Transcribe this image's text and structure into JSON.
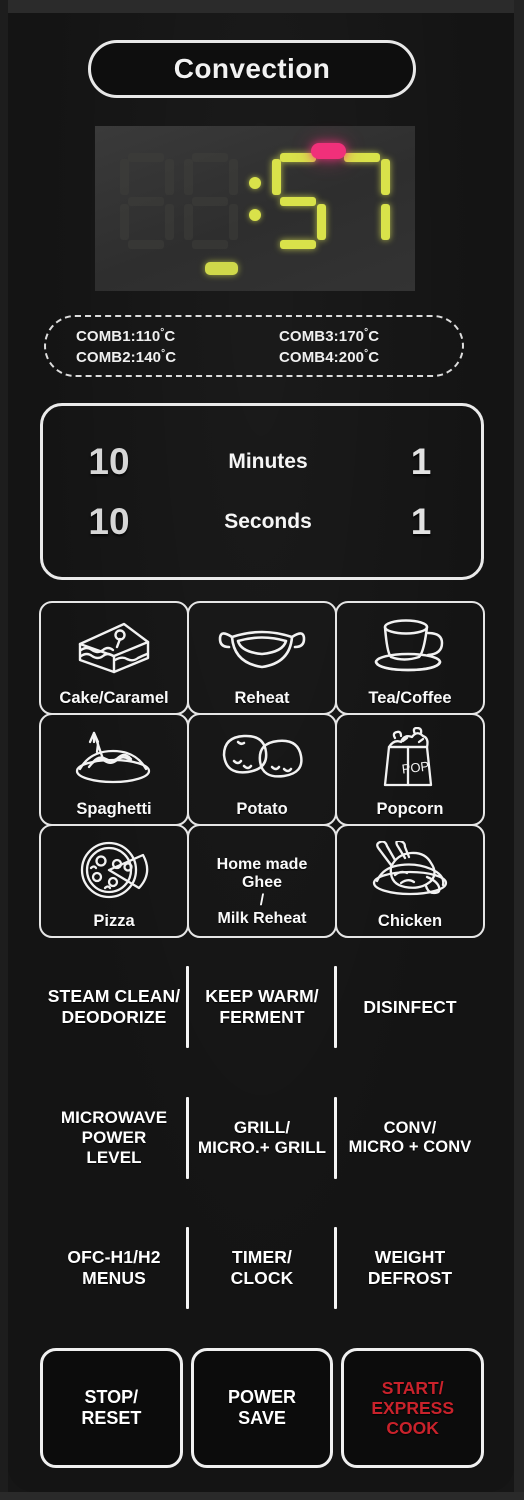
{
  "panel": {
    "header_label": "Convection",
    "accent_red": "#c9222b",
    "led_yellow": "#d9e24a",
    "led_pink": "#f0307a"
  },
  "display": {
    "digits": [
      {
        "value": "8",
        "lit": false
      },
      {
        "value": "8",
        "lit": false
      },
      {
        "value": "5",
        "lit": true
      },
      {
        "value": "7",
        "lit": true
      }
    ],
    "colon": ":",
    "readout": ":57",
    "indicator_pink": "cooking-indicator",
    "indicator_yellow": "mode-indicator"
  },
  "comb": {
    "left": [
      "COMB1:110°C",
      "COMB2:140°C"
    ],
    "right": [
      "COMB3:170°C",
      "COMB4:200°C"
    ],
    "items": [
      {
        "label": "COMB1",
        "temp": "110",
        "unit": "°C"
      },
      {
        "label": "COMB2",
        "temp": "140",
        "unit": "°C"
      },
      {
        "label": "COMB3",
        "temp": "170",
        "unit": "°C"
      },
      {
        "label": "COMB4",
        "temp": "200",
        "unit": "°C"
      }
    ]
  },
  "numpad": {
    "rows": [
      {
        "big": "10",
        "unit": "Minutes",
        "one": "1"
      },
      {
        "big": "10",
        "unit": "Seconds",
        "one": "1"
      }
    ]
  },
  "menu_grid": [
    {
      "label": "Cake/Caramel",
      "icon": "cake-slice-icon"
    },
    {
      "label": "Reheat",
      "icon": "bowl-icon"
    },
    {
      "label": "Tea/Coffee",
      "icon": "coffee-cup-icon"
    },
    {
      "label": "Spaghetti",
      "icon": "spaghetti-plate-icon"
    },
    {
      "label": "Potato",
      "icon": "potato-icon"
    },
    {
      "label": "Popcorn",
      "icon": "popcorn-bag-icon",
      "icon_text": "POP"
    },
    {
      "label": "Pizza",
      "icon": "pizza-icon"
    },
    {
      "label": "Home made Ghee\n/\nMilk Reheat",
      "line1": "Home made",
      "line2": "Ghee",
      "line3": "/",
      "line4": "Milk Reheat",
      "icon": "none"
    },
    {
      "label": "Chicken",
      "icon": "roast-chicken-icon"
    }
  ],
  "function_rows": [
    {
      "cells": [
        {
          "line1": "STEAM CLEAN/",
          "line2": "DEODORIZE"
        },
        {
          "line1": "KEEP WARM/",
          "line2": "FERMENT"
        },
        {
          "line1": "DISINFECT",
          "line2": ""
        }
      ]
    },
    {
      "cells": [
        {
          "line1": "MICROWAVE",
          "line2": "POWER",
          "line3": "LEVEL"
        },
        {
          "line1": "GRILL/",
          "line2": "MICRO.+ GRILL"
        },
        {
          "line1": "CONV/",
          "line2": "MICRO + CONV"
        }
      ]
    },
    {
      "cells": [
        {
          "line1": "OFC-H1/H2",
          "line2": "MENUS"
        },
        {
          "line1": "TIMER/",
          "line2": "CLOCK"
        },
        {
          "line1": "WEIGHT",
          "line2": "DEFROST"
        }
      ]
    }
  ],
  "bottom_buttons": [
    {
      "line1": "STOP/",
      "line2": "RESET",
      "line3": "",
      "color": "white"
    },
    {
      "line1": "POWER",
      "line2": "SAVE",
      "line3": "",
      "color": "white"
    },
    {
      "line1": "START/",
      "line2": "EXPRESS",
      "line3": "COOK",
      "color": "red"
    }
  ]
}
